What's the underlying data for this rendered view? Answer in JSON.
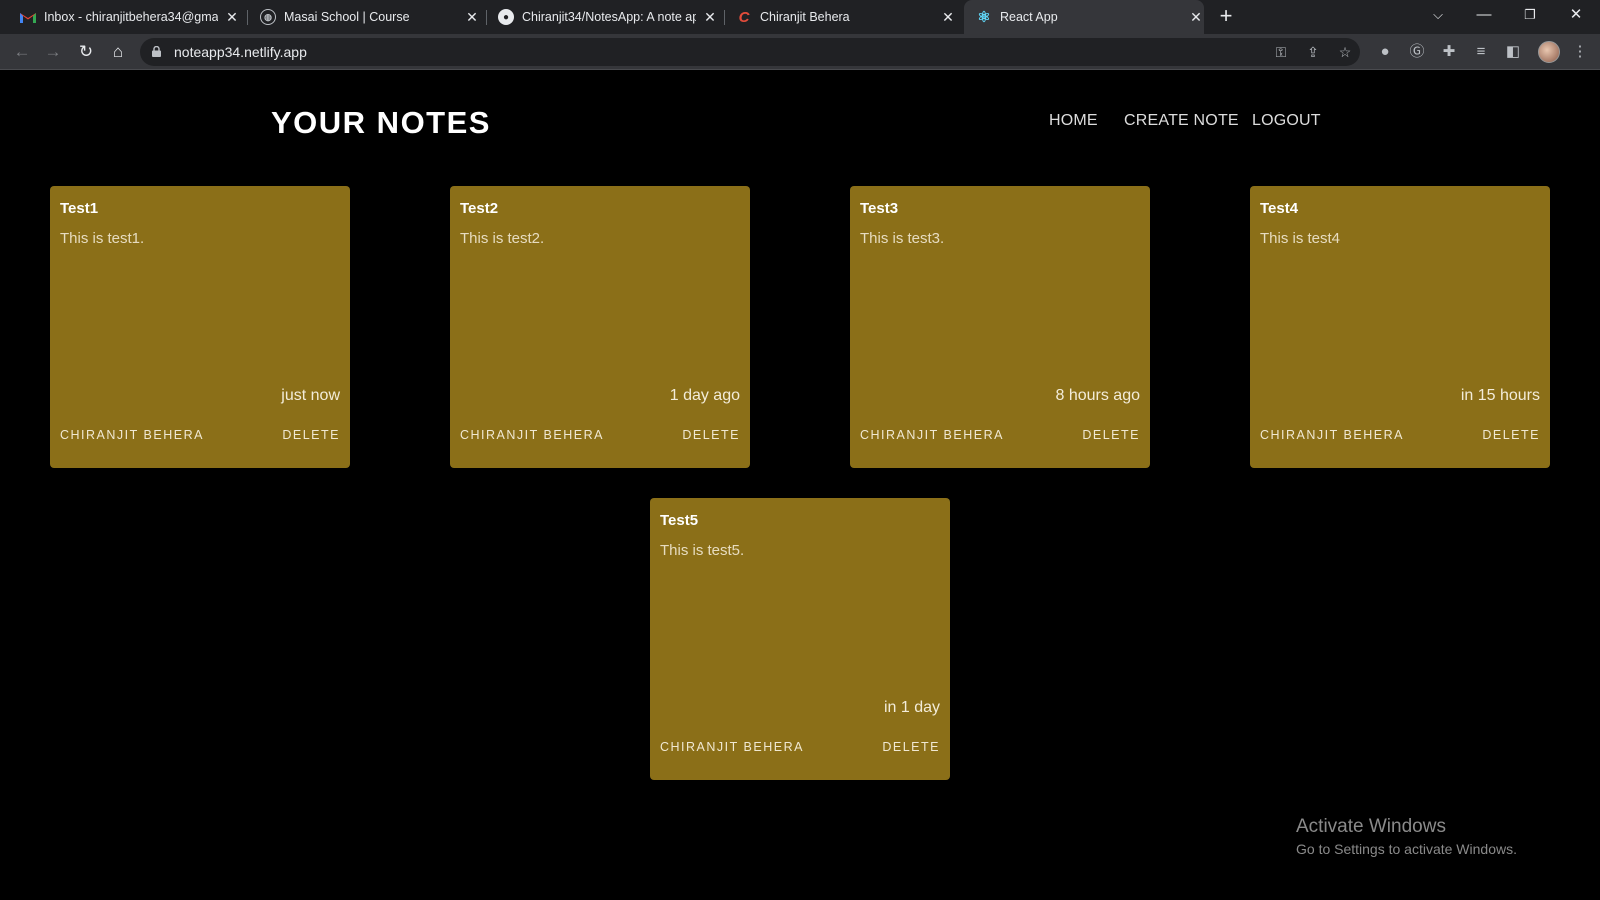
{
  "browser": {
    "tabs": [
      {
        "title": "Inbox - chiranjitbehera34@gmail.",
        "icon": "gmail-icon"
      },
      {
        "title": "Masai School | Course",
        "icon": "globe-icon"
      },
      {
        "title": "Chiranjit34/NotesApp: A note ap",
        "icon": "github-icon"
      },
      {
        "title": "Chiranjit Behera",
        "icon": "profile-logo-icon"
      },
      {
        "title": "React App",
        "icon": "react-icon"
      }
    ],
    "active_tab": 4,
    "url": "noteapp34.netlify.app"
  },
  "header": {
    "brand": "YOUR NOTES",
    "nav": {
      "home": "HOME",
      "create": "CREATE NOTE",
      "logout": "LOGOUT"
    }
  },
  "notes": [
    {
      "title": "Test1",
      "content": "This is test1.",
      "time": "just now",
      "author": "CHIRANJIT BEHERA",
      "delete_label": "DELETE"
    },
    {
      "title": "Test2",
      "content": "This is test2.",
      "time": "1 day ago",
      "author": "CHIRANJIT BEHERA",
      "delete_label": "DELETE"
    },
    {
      "title": "Test3",
      "content": "This is test3.",
      "time": "8 hours ago",
      "author": "CHIRANJIT BEHERA",
      "delete_label": "DELETE"
    },
    {
      "title": "Test4",
      "content": "This is test4",
      "time": "in 15 hours",
      "author": "CHIRANJIT BEHERA",
      "delete_label": "DELETE"
    },
    {
      "title": "Test5",
      "content": "This is test5.",
      "time": "in 1 day",
      "author": "CHIRANJIT BEHERA",
      "delete_label": "DELETE"
    }
  ],
  "watermark": {
    "title": "Activate Windows",
    "subtitle": "Go to Settings to activate Windows."
  },
  "colors": {
    "card": "#8b6f18",
    "page_bg": "#000000",
    "chrome_tabbar": "#202124",
    "chrome_toolbar": "#35363a"
  }
}
